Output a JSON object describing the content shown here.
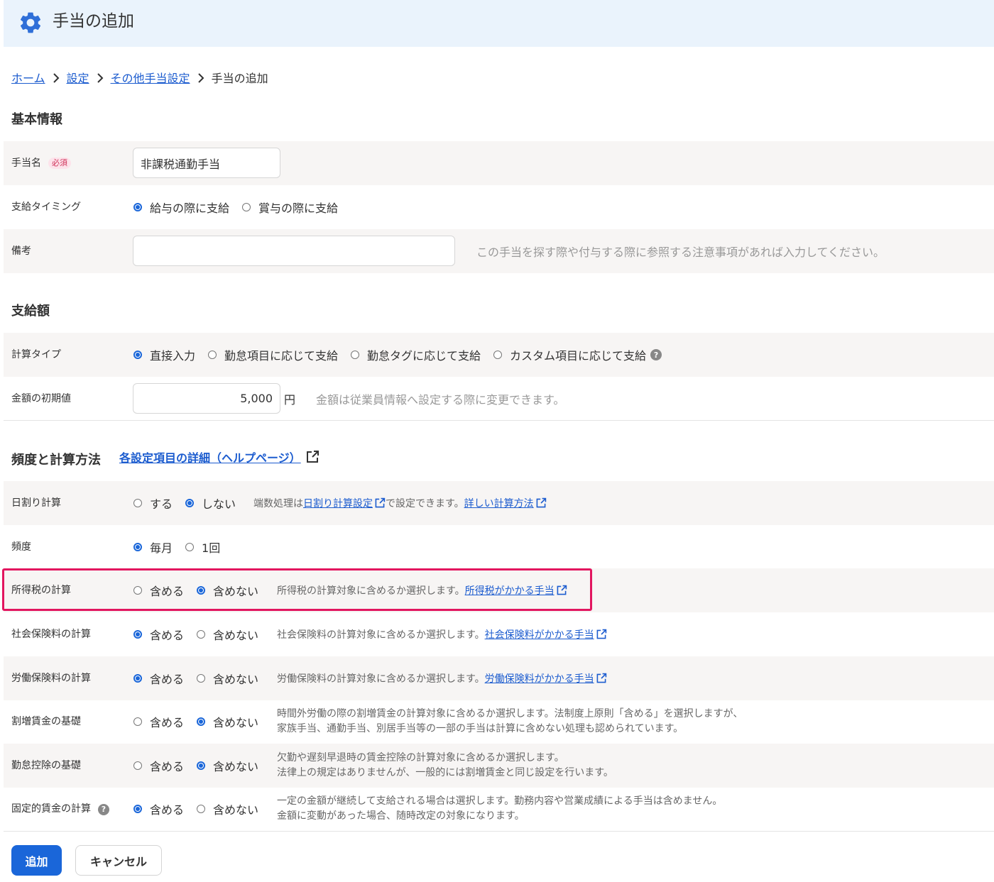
{
  "header": {
    "title": "手当の追加",
    "icon": "gear-icon",
    "bg_color": "#eaf3fc"
  },
  "breadcrumb": {
    "home": "ホーム",
    "settings": "設定",
    "other": "その他手当設定",
    "current": "手当の追加"
  },
  "basic": {
    "title": "基本情報",
    "name_label": "手当名",
    "required_badge": "必須",
    "name_value": "非課税通勤手当",
    "timing_label": "支給タイミング",
    "timing_opt1": "給与の際に支給",
    "timing_opt2": "賞与の際に支給",
    "timing_selected": "給与の際に支給",
    "note_label": "備考",
    "note_value": "",
    "note_hint": "この手当を探す際や付与する際に参照する注意事項があれば入力してください。"
  },
  "amount": {
    "title": "支給額",
    "calc_type_label": "計算タイプ",
    "calc_opt1": "直接入力",
    "calc_opt2": "勤怠項目に応じて支給",
    "calc_opt3": "勤怠タグに応じて支給",
    "calc_opt4": "カスタム項目に応じて支給",
    "calc_selected": "直接入力",
    "default_label": "金額の初期値",
    "default_value": "5,000",
    "unit": "円",
    "default_hint": "金額は従業員情報へ設定する際に変更できます。"
  },
  "freq": {
    "title": "頻度と計算方法",
    "help_link": "各設定項目の詳細（ヘルプページ）",
    "daily_label": "日割り計算",
    "daily_opt1": "する",
    "daily_opt2": "しない",
    "daily_selected": "しない",
    "daily_hint_a": "端数処理は",
    "daily_hint_link1": "日割り計算設定",
    "daily_hint_b": "で設定できます。",
    "daily_hint_link2": "詳しい計算方法",
    "frequency_label": "頻度",
    "frequency_opt1": "毎月",
    "frequency_opt2": "1回",
    "frequency_selected": "毎月",
    "income_tax_label": "所得税の計算",
    "income_tax_opt1": "含める",
    "income_tax_opt2": "含めない",
    "income_tax_selected": "含めない",
    "income_tax_hint": "所得税の計算対象に含めるか選択します。",
    "income_tax_link": "所得税がかかる手当",
    "social_label": "社会保険料の計算",
    "social_opt1": "含める",
    "social_opt2": "含めない",
    "social_selected": "含める",
    "social_hint": "社会保険料の計算対象に含めるか選択します。",
    "social_link": "社会保険料がかかる手当",
    "labor_label": "労働保険料の計算",
    "labor_opt1": "含める",
    "labor_opt2": "含めない",
    "labor_selected": "含める",
    "labor_hint": "労働保険料の計算対象に含めるか選択します。",
    "labor_link": "労働保険料がかかる手当",
    "overtime_label": "割増賃金の基礎",
    "overtime_opt1": "含める",
    "overtime_opt2": "含めない",
    "overtime_selected": "含めない",
    "overtime_hint1": "時間外労働の際の割増賃金の計算対象に含めるか選択します。法制度上原則「含める」を選択しますが、",
    "overtime_hint2": "家族手当、通勤手当、別居手当等の一部の手当は計算に含めない処理も認められています。",
    "deduction_label": "勤怠控除の基礎",
    "deduction_opt1": "含める",
    "deduction_opt2": "含めない",
    "deduction_selected": "含めない",
    "deduction_hint1": "欠勤や遅刻早退時の賃金控除の計算対象に含めるか選択します。",
    "deduction_hint2": "法律上の規定はありませんが、一般的には割増賃金と同じ設定を行います。",
    "fixed_label": "固定的賃金の計算",
    "fixed_opt1": "含める",
    "fixed_opt2": "含めない",
    "fixed_selected": "含める",
    "fixed_hint1": "一定の金額が継続して支給される場合は選択します。勤務内容や営業成績による手当は含めません。",
    "fixed_hint2": "金額に変動があった場合、随時改定の対象になります。"
  },
  "actions": {
    "add": "追加",
    "cancel": "キャンセル"
  },
  "colors": {
    "accent": "#1a66d9",
    "link": "#1c5ccf",
    "highlight": "#e2165f",
    "row_shade": "#f7f5f4"
  }
}
